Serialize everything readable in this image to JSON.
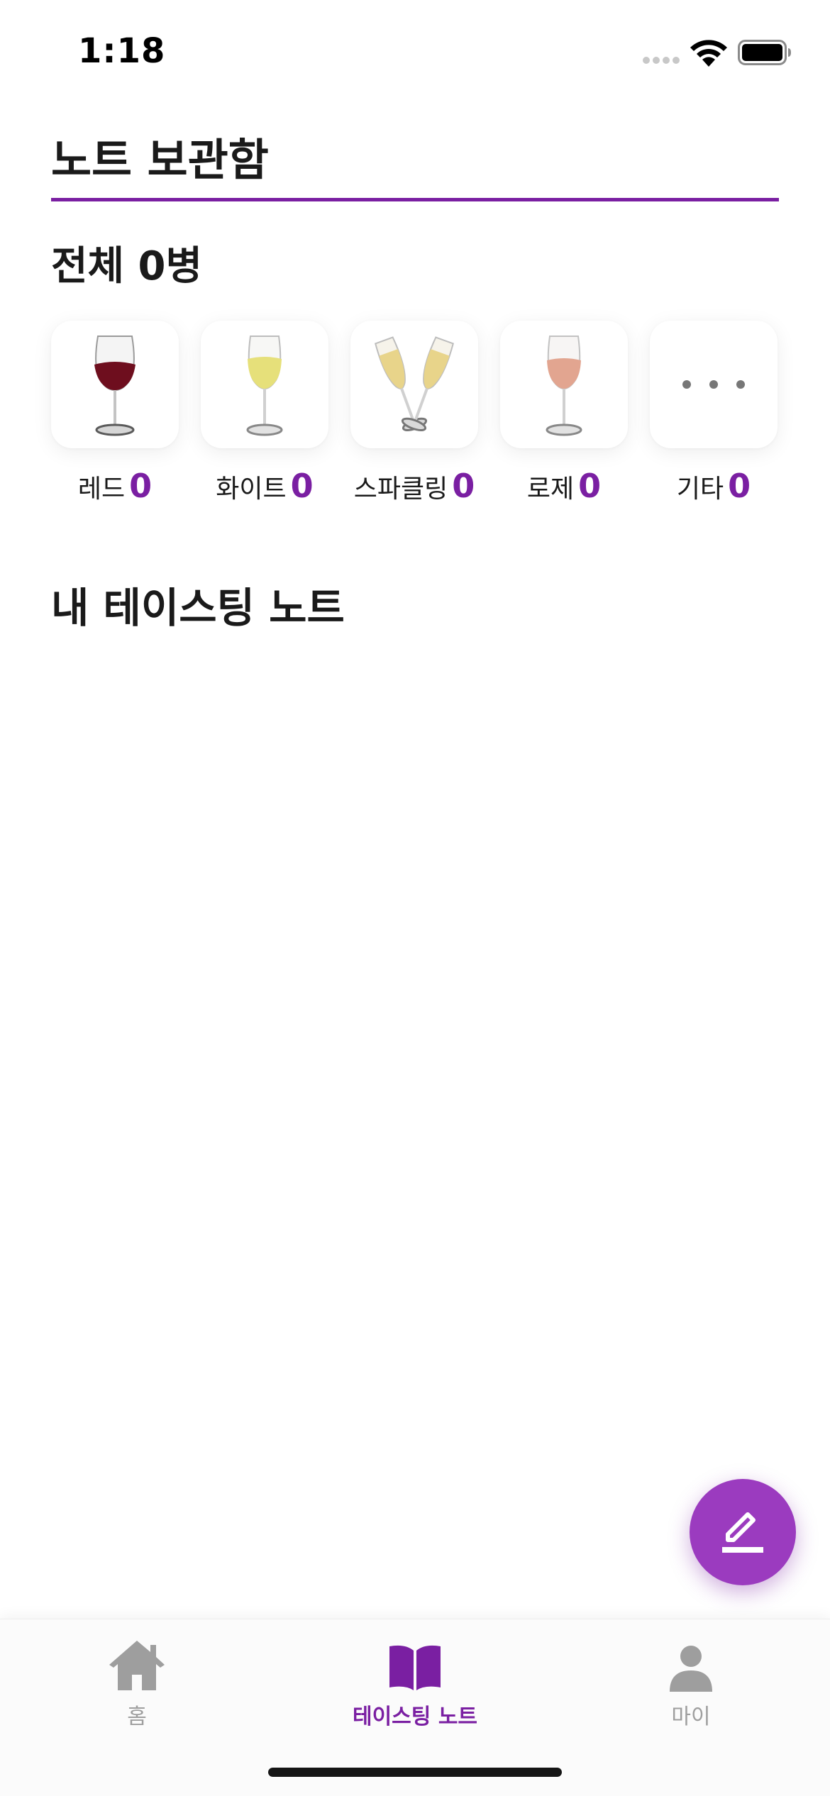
{
  "status_bar": {
    "time": "1:18"
  },
  "header": {
    "title": "노트 보관함"
  },
  "summary": {
    "total": "전체 0병"
  },
  "categories": [
    {
      "label": "레드",
      "count": "0",
      "icon": "red-wine-glass-icon",
      "color": "#6e0e1e"
    },
    {
      "label": "화이트",
      "count": "0",
      "icon": "white-wine-glass-icon",
      "color": "#e6e07a"
    },
    {
      "label": "스파클링",
      "count": "0",
      "icon": "sparkling-wine-glasses-icon",
      "color": "#e8d48a"
    },
    {
      "label": "로제",
      "count": "0",
      "icon": "rose-wine-glass-icon",
      "color": "#e2a590"
    },
    {
      "label": "기타",
      "count": "0",
      "icon": "more-dots-icon",
      "color": "#777777"
    }
  ],
  "notes_section": {
    "title": "내 테이스팅 노트"
  },
  "fab": {
    "icon": "pencil-edit-icon"
  },
  "tabs": [
    {
      "label": "홈",
      "icon": "home-icon",
      "active": false
    },
    {
      "label": "테이스팅 노트",
      "icon": "open-book-icon",
      "active": true
    },
    {
      "label": "마이",
      "icon": "person-icon",
      "active": false
    }
  ],
  "colors": {
    "accent": "#7a1fa2",
    "fab": "#9b3bbf",
    "inactive": "#9e9e9e"
  }
}
